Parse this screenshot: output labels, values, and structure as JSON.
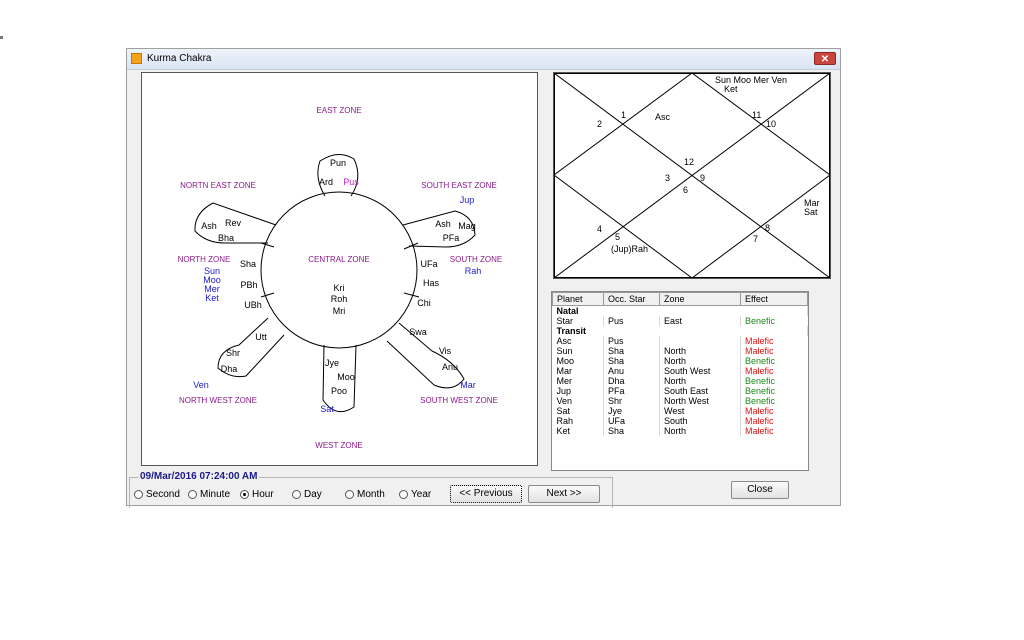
{
  "window": {
    "title": "Kurma Chakra"
  },
  "zones": {
    "east": "EAST ZONE",
    "north_east": "NORTN EAST ZONE",
    "south_east": "SOUTH EAST ZONE",
    "north": "NORTH ZONE",
    "central": "CENTRAL ZONE",
    "south": "SOUTH ZONE",
    "north_west": "NORTH WEST ZONE",
    "south_west": "SOUTH WEST ZONE",
    "west": "WEST ZONE"
  },
  "stars": {
    "east": [
      "Pun",
      "Ard"
    ],
    "north_east": [
      "Ash",
      "Rev",
      "Bha"
    ],
    "south_east": [
      "Ash",
      "Mag",
      "PFa"
    ],
    "north": [
      "Sha",
      "PBh",
      "UBh"
    ],
    "central": [
      "Kri",
      "Roh",
      "Mri"
    ],
    "south": [
      "UFa",
      "Has",
      "Chi"
    ],
    "north_west": [
      "Utt",
      "Shr",
      "Dha"
    ],
    "west": [
      "Jye",
      "Moo",
      "Poo"
    ],
    "south_west": [
      "Swa",
      "Vis",
      "Anu"
    ]
  },
  "planets": {
    "east": [
      "Pus"
    ],
    "south_east": [
      "Jup"
    ],
    "north": [
      "Sun",
      "Moo",
      "Mer",
      "Ket"
    ],
    "south": [
      "Rah"
    ],
    "north_west": [
      "Ven"
    ],
    "west": [
      "Sat"
    ],
    "south_west": [
      "Mar"
    ]
  },
  "chart": {
    "houses": [
      "1",
      "2",
      "3",
      "4",
      "5",
      "6",
      "7",
      "8",
      "9",
      "10",
      "11",
      "12"
    ],
    "asc": "Asc",
    "top_planets_line1": "Sun Moo Mer Ven",
    "top_planets_line2": "Ket",
    "right_planets_line1": "Mar",
    "right_planets_line2": "Sat",
    "bottom_left_planets": "(Jup)Rah"
  },
  "table": {
    "headers": [
      "Planet",
      "Occ. Star",
      "Zone",
      "Effect"
    ],
    "natal_label": "Natal",
    "natal_rows": [
      {
        "planet": "Star",
        "star": "Pus",
        "zone": "East",
        "effect": "Benefic"
      }
    ],
    "transit_label": "Transit",
    "transit_rows": [
      {
        "planet": "Asc",
        "star": "Pus",
        "zone": "",
        "effect": "Malefic"
      },
      {
        "planet": "Sun",
        "star": "Sha",
        "zone": "North",
        "effect": "Malefic"
      },
      {
        "planet": "Moo",
        "star": "Sha",
        "zone": "North",
        "effect": "Benefic"
      },
      {
        "planet": "Mar",
        "star": "Anu",
        "zone": "South West",
        "effect": "Malefic"
      },
      {
        "planet": "Mer",
        "star": "Dha",
        "zone": "North",
        "effect": "Benefic"
      },
      {
        "planet": "Jup",
        "star": "PFa",
        "zone": "South East",
        "effect": "Benefic"
      },
      {
        "planet": "Ven",
        "star": "Shr",
        "zone": "North West",
        "effect": "Benefic"
      },
      {
        "planet": "Sat",
        "star": "Jye",
        "zone": "West",
        "effect": "Malefic"
      },
      {
        "planet": "Rah",
        "star": "UFa",
        "zone": "South",
        "effect": "Malefic"
      },
      {
        "planet": "Ket",
        "star": "Sha",
        "zone": "North",
        "effect": "Malefic"
      }
    ]
  },
  "datetime": "09/Mar/2016 07:24:00 AM",
  "radios": {
    "second": "Second",
    "minute": "Minute",
    "hour": "Hour",
    "day": "Day",
    "month": "Month",
    "year": "Year"
  },
  "buttons": {
    "previous": "<< Previous",
    "next": "Next >>",
    "close": "Close"
  },
  "colors": {
    "zone": "#8b1a8b",
    "planet": "#1a1acc",
    "pus": "#cc22cc",
    "benefic": "#1a8a1a",
    "malefic": "#dd1111"
  }
}
